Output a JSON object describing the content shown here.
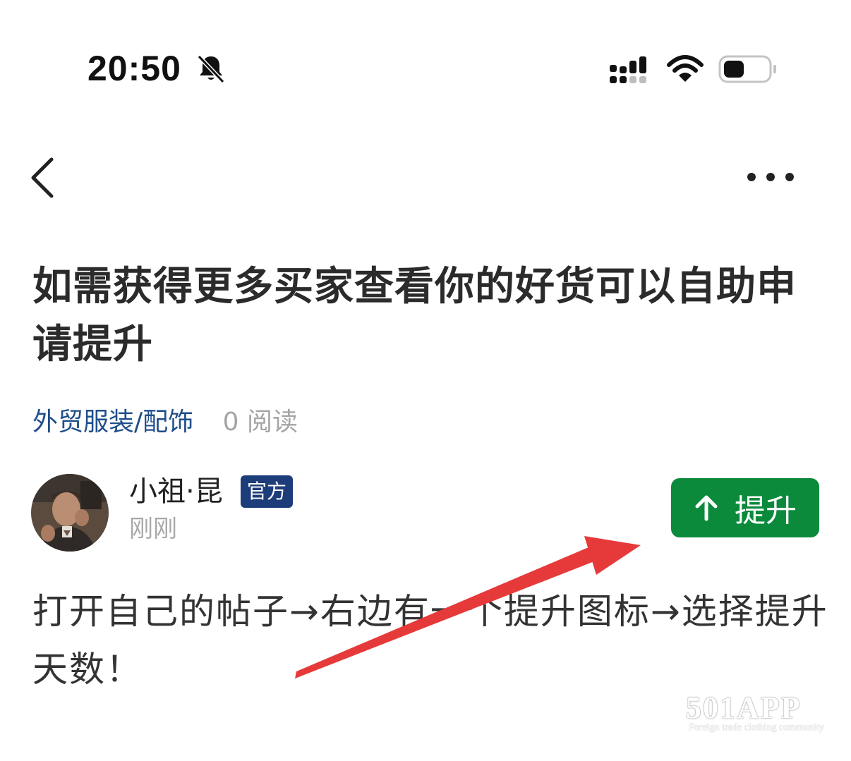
{
  "status_bar": {
    "time": "20:50",
    "icons": [
      "bell-slash-icon",
      "cellular-signal-icon",
      "wifi-icon",
      "battery-icon"
    ]
  },
  "nav": {
    "back_icon": "chevron-left-icon",
    "more_icon": "more-dots-icon"
  },
  "post": {
    "title": "如需获得更多买家查看你的好货可以自助申请提升",
    "category": "外贸服装/配饰",
    "reads": "0 阅读",
    "author": {
      "name": "小祖·昆",
      "badge": "官方",
      "time": "刚刚"
    },
    "boost_label": "提升",
    "content": "打开自己的帖子→右边有一个提升图标→选择提升天数！"
  },
  "watermark": {
    "main": "501APP",
    "sub": "Foreign trade clothing community"
  },
  "colors": {
    "category": "#1f4e8a",
    "badge_bg": "#1d3d7a",
    "boost_bg": "#0b8a3c",
    "annotation_arrow": "#e63a3a"
  }
}
